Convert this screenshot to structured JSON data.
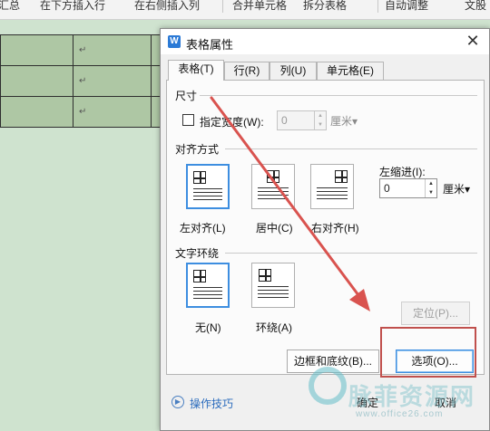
{
  "ribbon": {
    "items": [
      "汇总",
      "在下方插入行",
      "在右侧插入列",
      "合并单元格",
      "拆分表格",
      "自动调整",
      "文股"
    ]
  },
  "document": {
    "paragraph_mark": "↵"
  },
  "dialog": {
    "icon_letter": "W",
    "title": "表格属性",
    "close_glyph": "✕",
    "tabs": [
      "表格(T)",
      "行(R)",
      "列(U)",
      "单元格(E)"
    ],
    "size_section": {
      "label": "尺寸",
      "checkbox_label": "指定宽度(W):",
      "width_value": "0",
      "unit": "厘米▾"
    },
    "align_section": {
      "label": "对齐方式",
      "options": [
        "左对齐(L)",
        "居中(C)",
        "右对齐(H)"
      ],
      "selected": "左对齐(L)",
      "indent_label": "左缩进(I):",
      "indent_value": "0",
      "indent_unit": "厘米▾"
    },
    "wrap_section": {
      "label": "文字环绕",
      "options": [
        "无(N)",
        "环绕(A)"
      ],
      "selected": "无(N)",
      "position_button": "定位(P)..."
    },
    "borders_button": "边框和底纹(B)...",
    "options_button": "选项(O)...",
    "help_text": "操作技巧",
    "ok_button": "确定",
    "cancel_button": "取消"
  },
  "watermark": {
    "text": "脉菲资源网",
    "url": "www.office26.com"
  },
  "colors": {
    "accent": "#3d8ee0",
    "highlight": "#c0504d",
    "table_cell": "#aec7a4",
    "background": "#cfe3cf"
  }
}
